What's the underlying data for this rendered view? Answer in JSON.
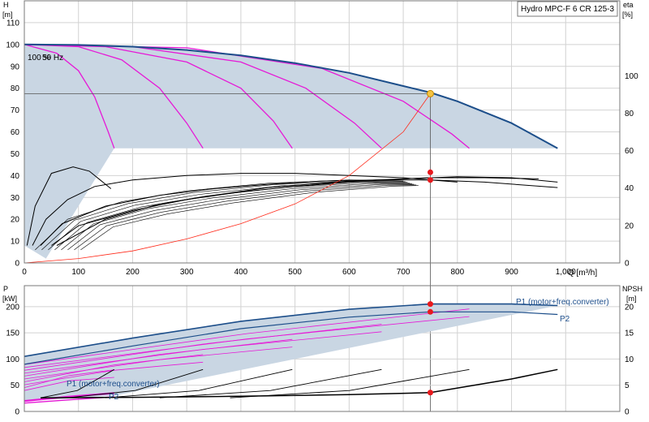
{
  "chart_data": [
    {
      "type": "line",
      "title": "Hydro MPC-F 6 CR 125-3",
      "xlabel": "Q [m³/h]",
      "ylabel_left": "H\n[m]",
      "ylabel_right": "eta\n[%]",
      "x_ticks": [
        "0",
        "100",
        "200",
        "300",
        "400",
        "500",
        "600",
        "700",
        "800",
        "900",
        "1,000"
      ],
      "y_ticks_left": [
        "0",
        "10",
        "20",
        "30",
        "40",
        "50",
        "60",
        "70",
        "80",
        "90",
        "100",
        "110"
      ],
      "y_ticks_right": [
        "0",
        "20",
        "40",
        "60",
        "80",
        "100"
      ],
      "xlim": [
        0,
        1100
      ],
      "ylim_left": [
        0,
        120
      ],
      "ylim_right": [
        0,
        140
      ],
      "annotations": [
        "100 %",
        "50 Hz"
      ],
      "colors": {
        "head_max": "#1c4e8a",
        "head_reduced": "#e619d7",
        "efficiency": "#000000",
        "system": "#ff2a1a",
        "area": "#c9d6e3",
        "duty": "#f5c342",
        "marker": "#e8191d"
      },
      "series": [
        {
          "role": "head_max",
          "x": [
            0,
            100,
            200,
            300,
            400,
            500,
            600,
            700,
            750,
            800,
            900,
            985
          ],
          "y": [
            100,
            99.8,
            99,
            97.5,
            95,
            91.5,
            87,
            81,
            78,
            74,
            64,
            52.5
          ]
        },
        {
          "role": "head_reduced",
          "curves": [
            {
              "x": [
                0,
                60,
                100,
                130,
                155,
                166
              ],
              "y": [
                100,
                96,
                88,
                76,
                60,
                52.5
              ]
            },
            {
              "x": [
                0,
                100,
                180,
                250,
                300,
                330
              ],
              "y": [
                100,
                99,
                93,
                80,
                64,
                52.5
              ]
            },
            {
              "x": [
                0,
                150,
                300,
                400,
                460,
                495
              ],
              "y": [
                100,
                99,
                92,
                80,
                65,
                52.5
              ]
            },
            {
              "x": [
                0,
                200,
                400,
                520,
                610,
                660
              ],
              "y": [
                100,
                99,
                92,
                80,
                64,
                52.5
              ]
            },
            {
              "x": [
                0,
                300,
                550,
                700,
                790,
                822
              ],
              "y": [
                100,
                98.5,
                89,
                74,
                59,
                52.5
              ]
            }
          ]
        },
        {
          "role": "system",
          "x": [
            0,
            100,
            200,
            300,
            400,
            500,
            600,
            700,
            750
          ],
          "y": [
            0,
            2,
            5.5,
            11,
            18,
            27,
            40,
            60,
            77.5
          ]
        },
        {
          "role": "efficiency",
          "curves": [
            {
              "x": [
                5,
                20,
                50,
                90,
                120,
                140,
                160
              ],
              "y": [
                8,
                26,
                41,
                44,
                42,
                38,
                34
              ]
            },
            {
              "x": [
                15,
                40,
                80,
                130,
                200,
                300,
                400,
                500,
                600,
                700,
                800
              ],
              "y": [
                8,
                20,
                29,
                35,
                38,
                40,
                41,
                41,
                40,
                39,
                37
              ]
            },
            {
              "x": [
                30,
                70,
                150,
                250,
                350,
                450,
                550,
                650,
                750,
                850,
                985
              ],
              "y": [
                8,
                18,
                26,
                31,
                34,
                36,
                37.5,
                38,
                38,
                37,
                34.5
              ]
            },
            {
              "x": [
                50,
                100,
                200,
                300,
                400,
                500,
                600,
                700,
                800,
                900,
                985
              ],
              "y": [
                8,
                17,
                24,
                29,
                32.5,
                35,
                37,
                38.5,
                39.5,
                39,
                37
              ]
            },
            {
              "x": [
                60,
                150,
                250,
                350,
                450,
                550,
                650,
                750,
                850,
                950
              ],
              "y": [
                8,
                20,
                27,
                31,
                34.5,
                36.5,
                38,
                39,
                39,
                38.5
              ]
            }
          ]
        }
      ],
      "duty_point": {
        "x": 750,
        "y": 77.5
      },
      "eta_markers": [
        {
          "x": 750,
          "y": 41.5
        },
        {
          "x": 750,
          "y": 38
        }
      ]
    },
    {
      "type": "line",
      "xlabel": "",
      "ylabel_left": "P\n[kW]",
      "ylabel_right": "NPSH\n[m]",
      "y_ticks_left": [
        "0",
        "50",
        "100",
        "150",
        "200"
      ],
      "y_ticks_right": [
        "0",
        "5",
        "10",
        "15",
        "20"
      ],
      "xlim": [
        0,
        1100
      ],
      "ylim_left": [
        0,
        240
      ],
      "ylim_right": [
        0,
        24
      ],
      "series": [
        {
          "name": "P1 (motor+freq.converter)",
          "role": "p1_top",
          "x": [
            0,
            200,
            400,
            600,
            750,
            900,
            985
          ],
          "y": [
            105,
            140,
            172,
            195,
            205,
            205,
            202
          ]
        },
        {
          "name": "P2",
          "role": "p2_top",
          "x": [
            0,
            200,
            400,
            600,
            750,
            900,
            985
          ],
          "y": [
            90,
            125,
            158,
            180,
            190,
            190,
            185
          ]
        },
        {
          "name": "P1 (motor+freq.converter)",
          "role": "p1_bottom",
          "x": [
            0,
            80,
            166
          ],
          "y": [
            20,
            28,
            35
          ]
        },
        {
          "name": "P2",
          "role": "p2_bottom",
          "x": [
            0,
            80,
            166
          ],
          "y": [
            16,
            22,
            28
          ]
        },
        {
          "role": "npsh",
          "x": [
            30,
            200,
            400,
            600,
            750,
            900,
            985
          ],
          "y": [
            2.6,
            2.7,
            2.9,
            3.2,
            3.6,
            6.2,
            8.0
          ]
        }
      ],
      "p_markers": [
        {
          "x": 750,
          "y": 205
        },
        {
          "x": 750,
          "y": 190
        }
      ],
      "npsh_marker": {
        "x": 750,
        "y": 3.6
      }
    }
  ]
}
